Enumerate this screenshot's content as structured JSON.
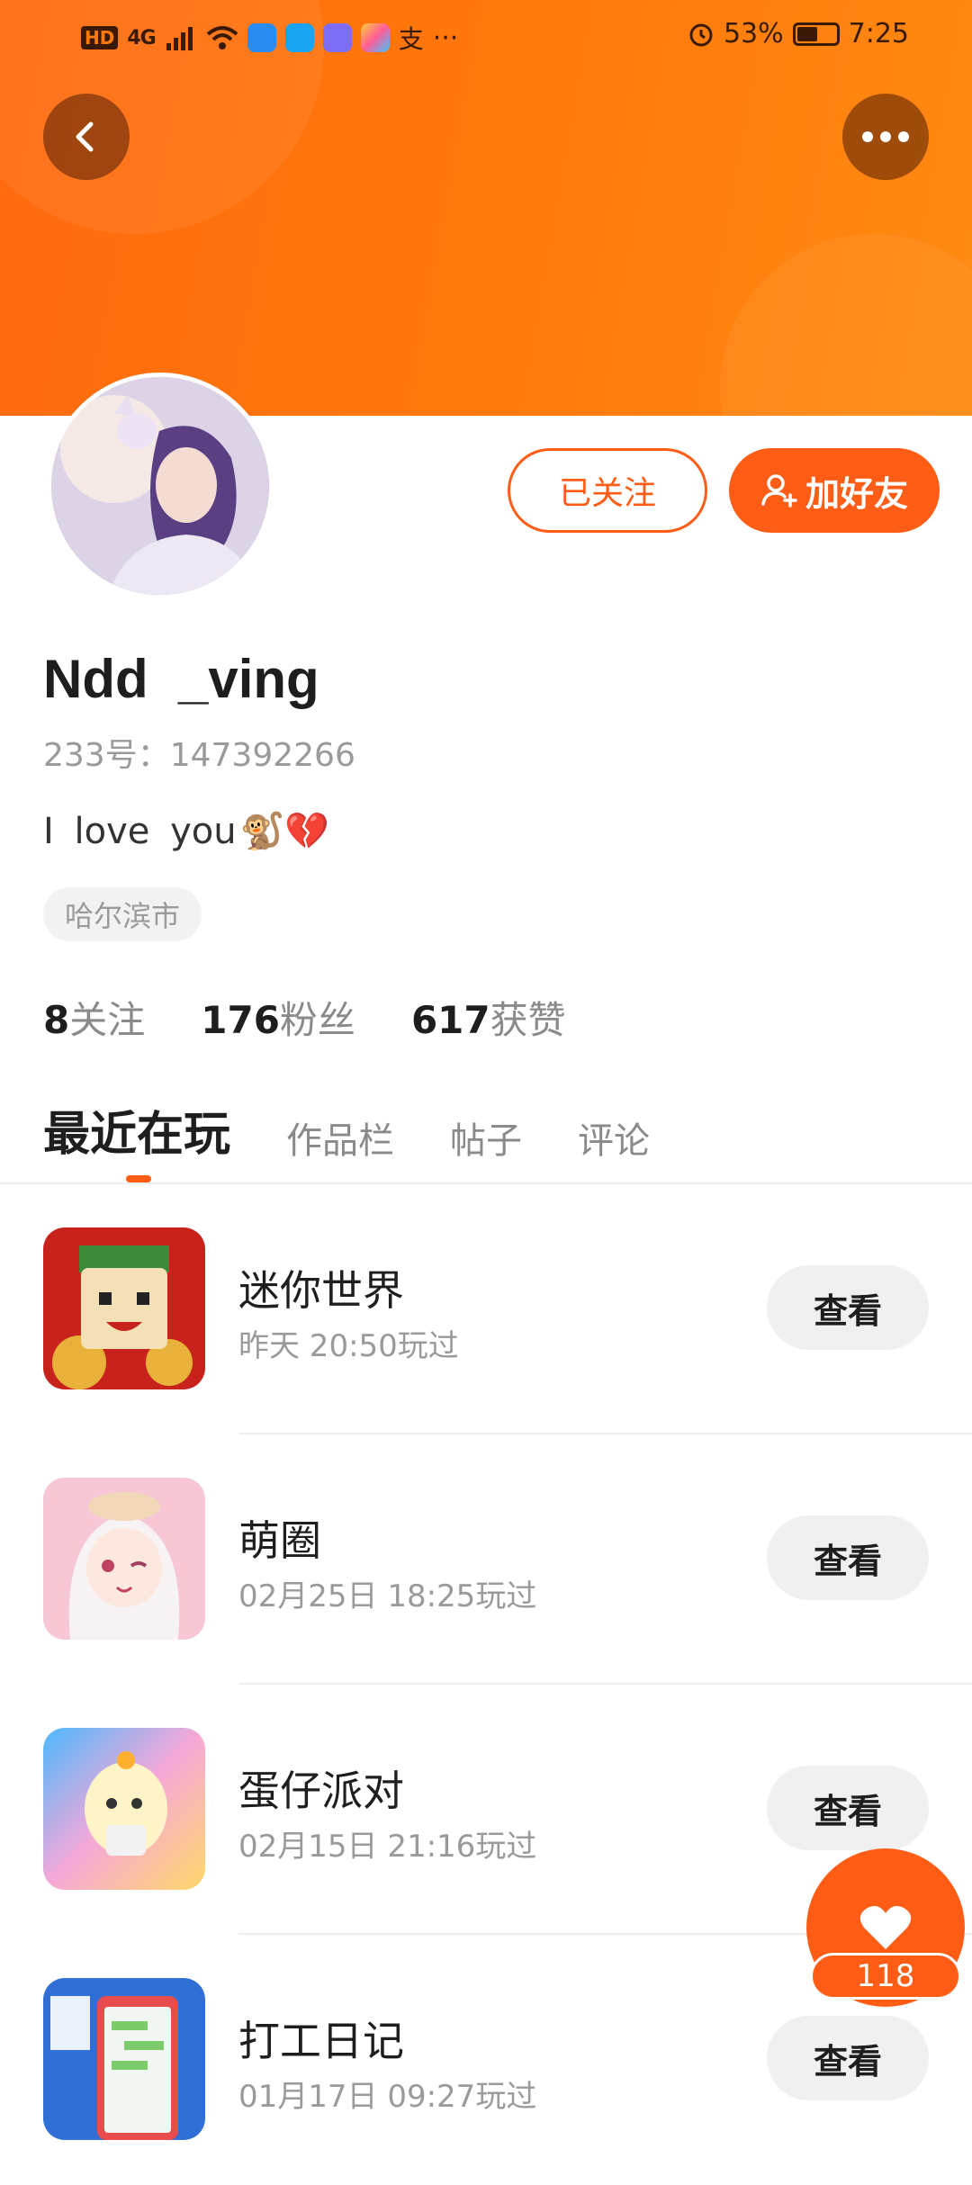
{
  "status_bar": {
    "network": "4G",
    "hd": "HD",
    "battery_percent": "53%",
    "battery_level": 0.53,
    "time": "7:25",
    "overflow": "···"
  },
  "profile": {
    "name": "Ndd  _ving",
    "id_label": "233号：147392266",
    "bio": "I love you",
    "bio_emojis": "🐒💔",
    "location": "哈尔滨市",
    "stats": [
      {
        "num": "8",
        "label": "关注"
      },
      {
        "num": "176",
        "label": "粉丝"
      },
      {
        "num": "617",
        "label": "获赞"
      }
    ]
  },
  "actions": {
    "followed_label": "已关注",
    "add_friend_label": "加好友"
  },
  "tabs": [
    {
      "label": "最近在玩",
      "active": true
    },
    {
      "label": "作品栏",
      "active": false
    },
    {
      "label": "帖子",
      "active": false
    },
    {
      "label": "评论",
      "active": false
    }
  ],
  "games": [
    {
      "title": "迷你世界",
      "time": "昨天 20:50玩过",
      "button": "查看"
    },
    {
      "title": "萌圈",
      "time": "02月25日 18:25玩过",
      "button": "查看"
    },
    {
      "title": "蛋仔派对",
      "time": "02月15日 21:16玩过",
      "button": "查看"
    },
    {
      "title": "打工日记",
      "time": "01月17日 09:27玩过",
      "button": "查看"
    }
  ],
  "like_fab": {
    "count": "118"
  },
  "colors": {
    "accent": "#ff5c16",
    "header": "#ff7a0c"
  }
}
